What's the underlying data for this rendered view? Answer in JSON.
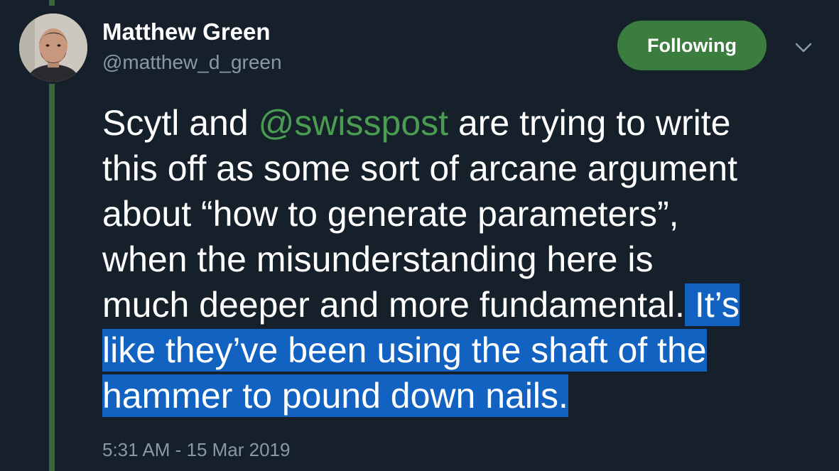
{
  "author": {
    "display_name": "Matthew Green",
    "handle": "@matthew_d_green",
    "avatar_icon": "user-avatar-photo"
  },
  "follow_button": {
    "label": "Following",
    "color": "#3b7d3f"
  },
  "menu": {
    "icon": "chevron-down-icon"
  },
  "tweet": {
    "lines": [
      {
        "pre": "Scytl and ",
        "mention": "@swisspost",
        "post": " are trying to write"
      },
      {
        "text": "this off as some sort of arcane argument"
      },
      {
        "text": "about “how to generate parameters”,"
      },
      {
        "text": "when the misunderstanding here is"
      },
      {
        "pre": "much deeper and more fundamental.",
        "highlight": " It’s "
      },
      {
        "highlight": "like they’ve been using the shaft of the "
      },
      {
        "highlight": "hammer to pound down nails."
      }
    ]
  },
  "timestamp": "5:31 AM - 15 Mar 2019",
  "colors": {
    "background": "#16202b",
    "mention": "#4a9c50",
    "selection": "#1262c1",
    "secondary_text": "#8899a6",
    "thread_line": "#38663f"
  }
}
